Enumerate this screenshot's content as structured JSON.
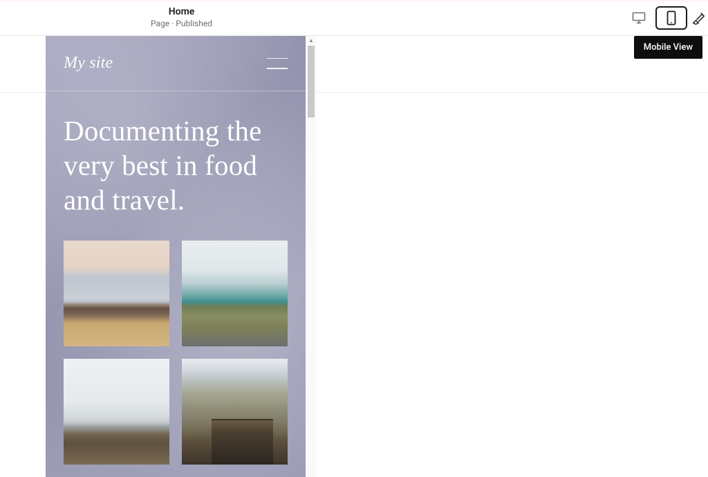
{
  "toolbar": {
    "title": "Home",
    "subtitle": "Page · Published",
    "tooltip": "Mobile View",
    "desktop_icon_name": "desktop-icon",
    "mobile_icon_name": "mobile-icon",
    "styles_icon_name": "paintbrush-icon"
  },
  "preview": {
    "site_title": "My site",
    "menu_icon_name": "hamburger-icon",
    "hero_heading": "Documenting the very best in food and travel.",
    "gallery": [
      {
        "alt": "lake-cabin"
      },
      {
        "alt": "turquoise-lake"
      },
      {
        "alt": "snowy-mountains"
      },
      {
        "alt": "mountain-barn"
      }
    ]
  }
}
